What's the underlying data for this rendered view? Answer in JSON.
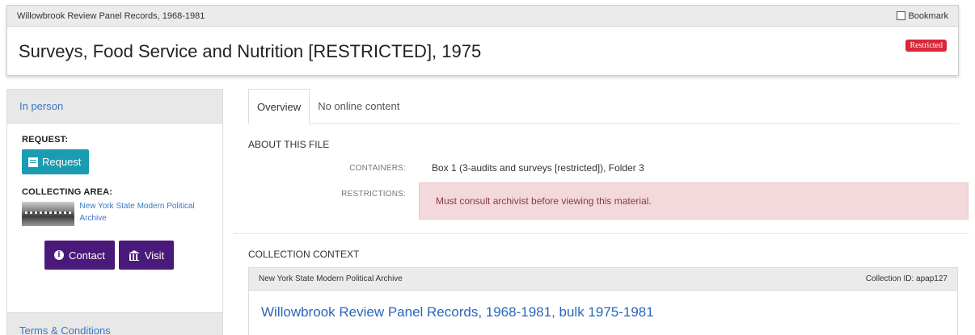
{
  "header": {
    "breadcrumb": "Willowbrook Review Panel Records, 1968-1981",
    "bookmark_label": "Bookmark",
    "title": "Surveys, Food Service and Nutrition [RESTRICTED], 1975",
    "badge": "Restricted"
  },
  "sidebar": {
    "tab_label": "In person",
    "request_label": "REQUEST:",
    "request_button": "Request",
    "collecting_area_label": "COLLECTING AREA:",
    "collecting_area_link": "New York State Modern Political Archive",
    "contact_button": "Contact",
    "visit_button": "Visit",
    "terms_label": "Terms & Conditions"
  },
  "main": {
    "tabs": [
      {
        "label": "Overview"
      },
      {
        "label": "No online content"
      }
    ],
    "about_heading": "ABOUT THIS FILE",
    "containers_label": "CONTAINERS:",
    "containers_value": "Box 1 (3-audits and surveys [restricted]), Folder 3",
    "restrictions_label": "RESTRICTIONS:",
    "restrictions_value": "Must consult archivist before viewing this material.",
    "context_heading": "COLLECTION CONTEXT",
    "context_repository": "New York State Modern Political Archive",
    "context_collection_id": "Collection ID: apap127",
    "context_link": "Willowbrook Review Panel Records, 1968-1981, bulk 1975-1981"
  },
  "colors": {
    "badge": "#d9283a",
    "request_button": "#1b9cb3",
    "purple_button": "#4a1a7a",
    "link": "#3a78c2",
    "restriction_bg": "#f3d8dc"
  },
  "icons": {
    "request": "document-icon",
    "contact": "info-circle-icon",
    "visit": "institution-icon"
  }
}
